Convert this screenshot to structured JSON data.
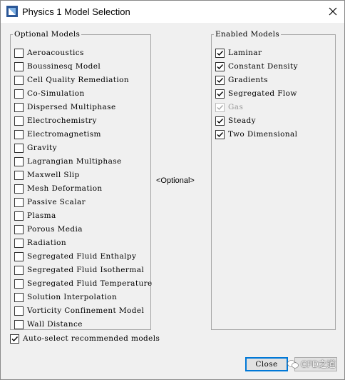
{
  "window": {
    "title": "Physics 1 Model Selection"
  },
  "optional_models": {
    "legend": "Optional Models",
    "items": [
      {
        "label": "Aeroacoustics",
        "checked": false
      },
      {
        "label": "Boussinesq Model",
        "checked": false
      },
      {
        "label": "Cell Quality Remediation",
        "checked": false
      },
      {
        "label": "Co-Simulation",
        "checked": false
      },
      {
        "label": "Dispersed Multiphase",
        "checked": false
      },
      {
        "label": "Electrochemistry",
        "checked": false
      },
      {
        "label": "Electromagnetism",
        "checked": false
      },
      {
        "label": "Gravity",
        "checked": false
      },
      {
        "label": "Lagrangian Multiphase",
        "checked": false
      },
      {
        "label": "Maxwell Slip",
        "checked": false
      },
      {
        "label": "Mesh Deformation",
        "checked": false
      },
      {
        "label": "Passive Scalar",
        "checked": false
      },
      {
        "label": "Plasma",
        "checked": false
      },
      {
        "label": "Porous Media",
        "checked": false
      },
      {
        "label": "Radiation",
        "checked": false
      },
      {
        "label": "Segregated Fluid Enthalpy",
        "checked": false
      },
      {
        "label": "Segregated Fluid Isothermal",
        "checked": false
      },
      {
        "label": "Segregated Fluid Temperature",
        "checked": false
      },
      {
        "label": "Solution Interpolation",
        "checked": false
      },
      {
        "label": "Vorticity Confinement Model",
        "checked": false
      },
      {
        "label": "Wall Distance",
        "checked": false
      }
    ]
  },
  "enabled_models": {
    "legend": "Enabled Models",
    "items": [
      {
        "label": "Laminar",
        "checked": true,
        "disabled": false
      },
      {
        "label": "Constant Density",
        "checked": true,
        "disabled": false
      },
      {
        "label": "Gradients",
        "checked": true,
        "disabled": false
      },
      {
        "label": "Segregated Flow",
        "checked": true,
        "disabled": false
      },
      {
        "label": "Gas",
        "checked": true,
        "disabled": true
      },
      {
        "label": "Steady",
        "checked": true,
        "disabled": false
      },
      {
        "label": "Two Dimensional",
        "checked": true,
        "disabled": false
      }
    ]
  },
  "center": {
    "optional_label": "<Optional>"
  },
  "auto_select": {
    "label": "Auto-select recommended models",
    "checked": true
  },
  "buttons": {
    "close_label": "Close"
  },
  "watermark": {
    "text": "CFD之道"
  },
  "icons": {
    "app": "simcenter-app-icon",
    "window_close": "close-icon",
    "watermark": "wechat-icon"
  },
  "colors": {
    "focus_border": "#0078d7",
    "app_icon_blue": "#2b5797"
  }
}
